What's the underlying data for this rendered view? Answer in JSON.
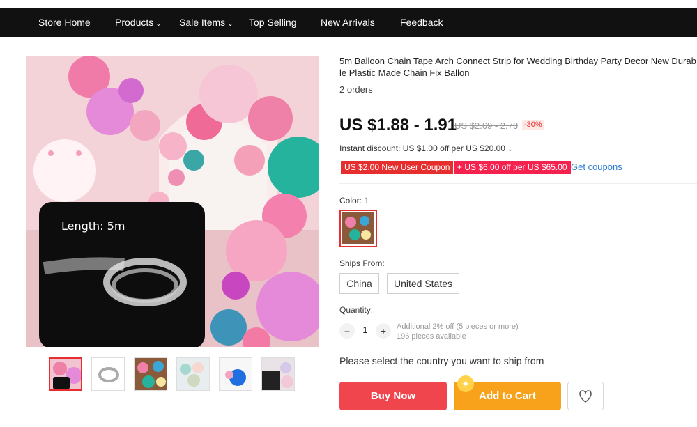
{
  "nav": {
    "items": [
      {
        "label": "Store Home",
        "has_caret": false
      },
      {
        "label": "Products",
        "has_caret": true
      },
      {
        "label": "Sale Items",
        "has_caret": true
      },
      {
        "label": "Top Selling",
        "has_caret": false
      },
      {
        "label": "New Arrivals",
        "has_caret": false
      },
      {
        "label": "Feedback",
        "has_caret": false
      }
    ]
  },
  "gallery": {
    "image_label": "Length: 5m",
    "thumbnail_count": 6,
    "active_thumbnail": 0
  },
  "product": {
    "title": "5m Balloon Chain Tape Arch Connect Strip for Wedding Birthday Party Decor New Durable Plastic Made Chain Fix Ballon",
    "orders": "2 orders",
    "price": "US $1.88 - 1.91",
    "original_price": "US $2.69 - 2.73",
    "discount": "-30%",
    "instant_discount": "Instant discount: US $1.00 off per US $20.00",
    "coupons": [
      "US $2.00 New User Coupon",
      "+ US $6.00 off per US $65.00"
    ],
    "get_coupons": "Get coupons",
    "color_label": "Color:",
    "color_value": "1",
    "ships_from_label": "Ships From:",
    "ships_from_options": [
      "China",
      "United States"
    ],
    "quantity_label": "Quantity:",
    "quantity": "1",
    "qty_minus": "−",
    "qty_plus": "+",
    "qty_note_1": "Additional 2% off (5 pieces or more)",
    "qty_note_2": "196 pieces available",
    "ship_prompt": "Please select the country you want to ship from",
    "buy_now": "Buy Now",
    "add_to_cart": "Add to Cart"
  },
  "colors": {
    "accent_red": "#e62e2e",
    "buy_now": "#f0454c",
    "add_to_cart": "#f7a21a",
    "link_blue": "#2b7cd3",
    "nav_bg": "#111111"
  }
}
